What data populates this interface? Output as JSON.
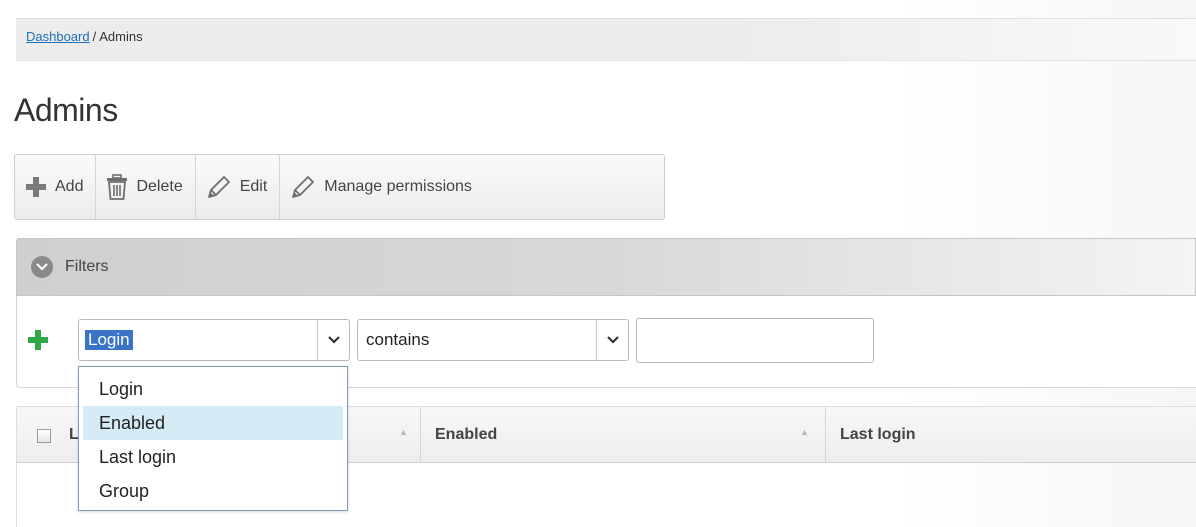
{
  "breadcrumb": {
    "link": "Dashboard",
    "separator": "/",
    "current": "Admins"
  },
  "page_title": "Admins",
  "toolbar": {
    "add": "Add",
    "delete": "Delete",
    "edit": "Edit",
    "manage": "Manage permissions"
  },
  "filters": {
    "title": "Filters",
    "field_value": "Login",
    "operator_value": "contains",
    "text_value": "",
    "field_options": [
      "Login",
      "Enabled",
      "Last login",
      "Group"
    ],
    "hovered_option": "Enabled"
  },
  "table": {
    "columns": [
      "Login",
      "Enabled",
      "Last login"
    ],
    "first_col_partial": "L"
  },
  "colors": {
    "accent": "#3a73c8",
    "link": "#1f6fb8",
    "add_green": "#2fa84a",
    "hover": "#d5ecf7"
  },
  "icons": [
    "plus-icon",
    "trash-icon",
    "pencil-icon",
    "chevron-down-icon",
    "green-plus-icon",
    "sort-asc-icon"
  ]
}
